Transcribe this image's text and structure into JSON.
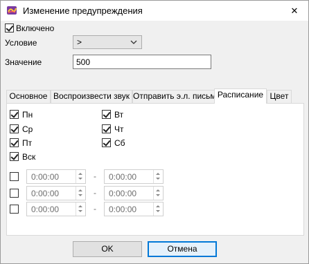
{
  "window": {
    "title": "Изменение предупреждения",
    "close_glyph": "✕"
  },
  "enabled": {
    "label": "Включено",
    "checked": true
  },
  "condition": {
    "label": "Условие",
    "value": ">"
  },
  "value_field": {
    "label": "Значение",
    "value": "500"
  },
  "tabs": [
    {
      "label": "Основное",
      "active": false
    },
    {
      "label": "Воспроизвести звук",
      "active": false
    },
    {
      "label": "Отправить э.л. письмо",
      "active": false
    },
    {
      "label": "Расписание",
      "active": true
    },
    {
      "label": "Цвет",
      "active": false
    }
  ],
  "schedule": {
    "days": [
      {
        "label": "Пн",
        "checked": true
      },
      {
        "label": "Вт",
        "checked": true
      },
      {
        "label": "Ср",
        "checked": true
      },
      {
        "label": "Чт",
        "checked": true
      },
      {
        "label": "Пт",
        "checked": true
      },
      {
        "label": "Сб",
        "checked": true
      },
      {
        "label": "Вск",
        "checked": true
      }
    ],
    "ranges": [
      {
        "enabled": false,
        "from": "0:00:00",
        "to": "0:00:00"
      },
      {
        "enabled": false,
        "from": "0:00:00",
        "to": "0:00:00"
      },
      {
        "enabled": false,
        "from": "0:00:00",
        "to": "0:00:00"
      }
    ],
    "separator": "-"
  },
  "buttons": {
    "ok": "OK",
    "cancel": "Отмена"
  },
  "colors": {
    "accent": "#0078d7",
    "panel": "#ffffff",
    "window": "#f0f0f0"
  }
}
